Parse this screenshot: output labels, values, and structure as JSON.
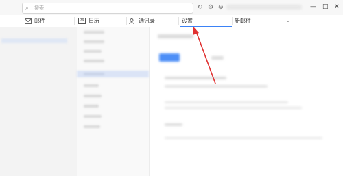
{
  "titlebar": {
    "search_placeholder": "搜索",
    "icons": [
      "grid-icon",
      "refresh-icon",
      "gear-icon",
      "minus-circle-icon",
      "minimize-icon",
      "maximize-icon",
      "close-icon"
    ]
  },
  "tabs": {
    "mail": "邮件",
    "calendar": "日历",
    "calendar_icon_day": "29",
    "contacts": "通讯录",
    "settings": "设置",
    "new_mail": "新邮件"
  },
  "colors": {
    "accent": "#3b82f6",
    "annotation": "#e03131"
  }
}
